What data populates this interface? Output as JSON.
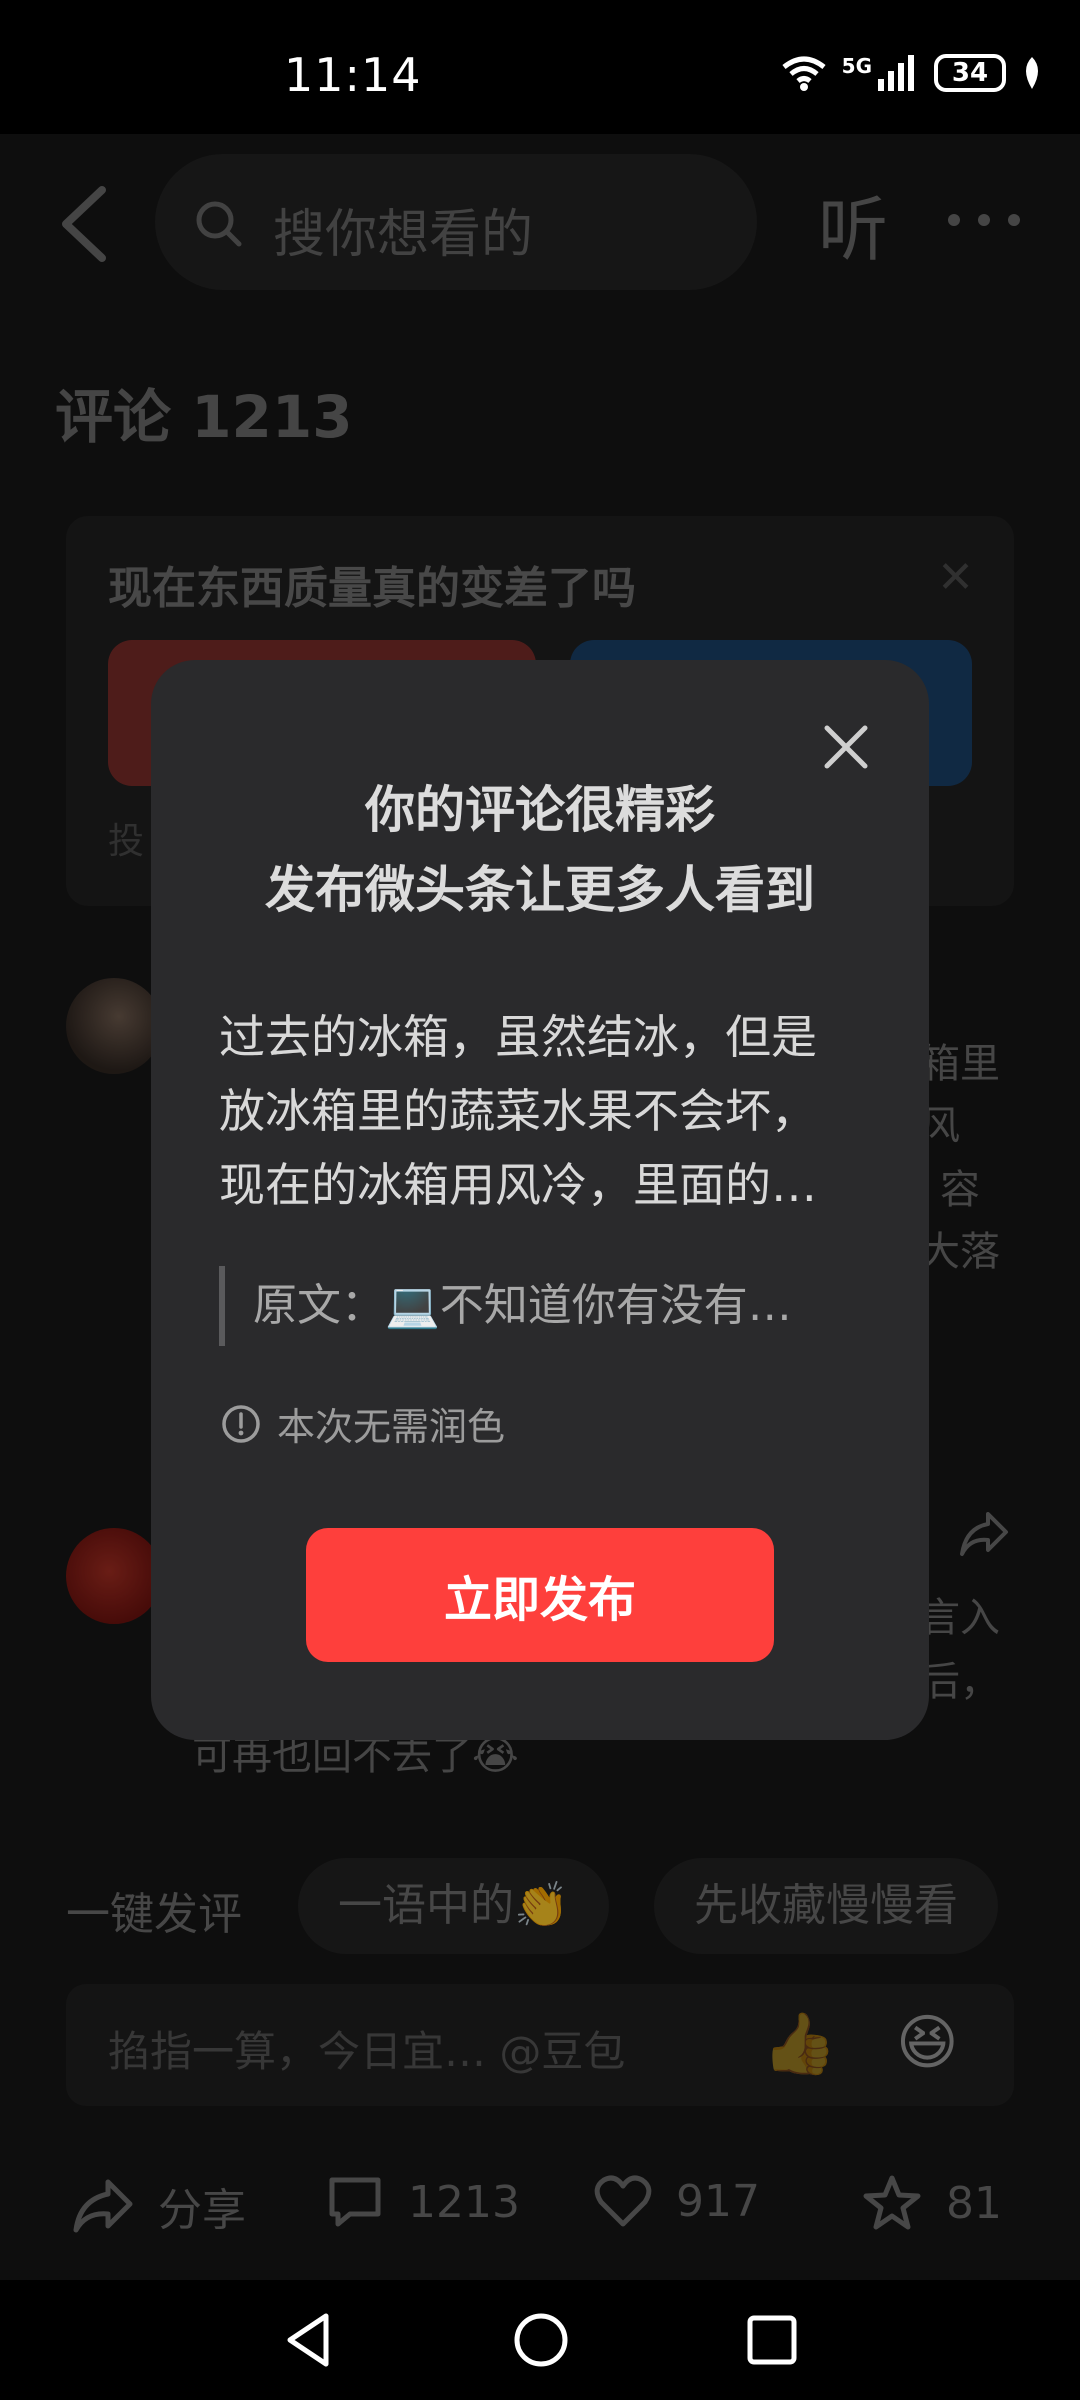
{
  "status_bar": {
    "time": "11:14",
    "network": "5G",
    "battery": "34"
  },
  "header": {
    "search_placeholder": "搜你想看的",
    "listen_label": "听"
  },
  "comments": {
    "title": "评论 1213"
  },
  "poll": {
    "question": "现在东西质量真的变差了吗",
    "hint": "投",
    "option_a_color": "#e53935",
    "option_b_color": "#1565c0"
  },
  "comment_snippets": [
    {
      "text": "箱里"
    },
    {
      "text": "风"
    },
    {
      "text": "容"
    },
    {
      "text": "大落"
    }
  ],
  "comment2": {
    "line1": "言入",
    "line2": "后，",
    "line3": "可再也回不去了😭"
  },
  "quick_replies": {
    "label": "一键发评",
    "chips": [
      "一语中的👏",
      "先收藏慢慢看"
    ]
  },
  "input": {
    "placeholder": "掐指一算，今日宜… @豆包",
    "emoji_thumb": "👍",
    "emoji_laugh": "😆"
  },
  "actions": {
    "share": "分享",
    "comments": "1213",
    "likes": "917",
    "favorites": "81"
  },
  "dialog": {
    "title_line1": "你的评论很精彩",
    "title_line2": "发布微头条让更多人看到",
    "body_line1": "过去的冰箱，虽然结冰，但是",
    "body_line2": "放冰箱里的蔬菜水果不会坏，",
    "body_line3": "现在的冰箱用风冷，里面的…",
    "quote": "原文：💻不知道你有没有…",
    "notice": "本次无需润色",
    "publish_button": "立即发布",
    "accent_color": "#fe3f3c"
  }
}
